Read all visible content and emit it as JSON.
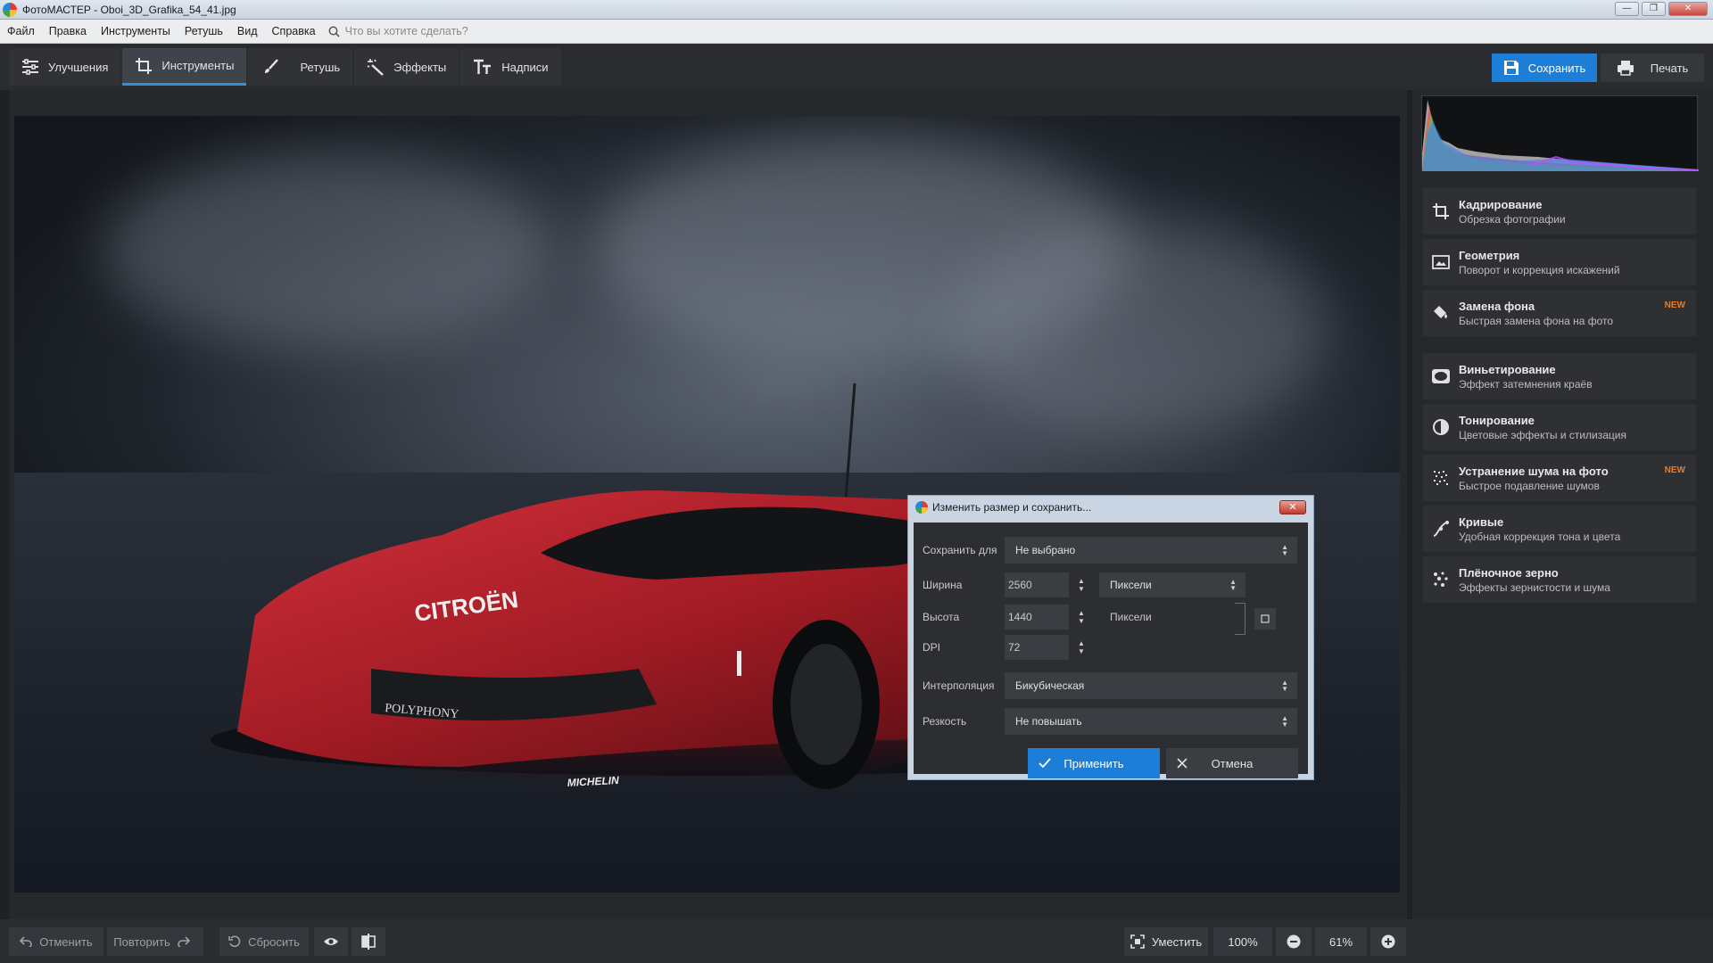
{
  "window": {
    "title": "ФотоМАСТЕР - Oboi_3D_Grafika_54_41.jpg"
  },
  "menu": {
    "items": [
      "Файл",
      "Правка",
      "Инструменты",
      "Ретушь",
      "Вид",
      "Справка"
    ],
    "search_placeholder": "Что вы хотите сделать?"
  },
  "toolbar": {
    "tabs": [
      "Улучшения",
      "Инструменты",
      "Ретушь",
      "Эффекты",
      "Надписи"
    ],
    "active_tab": "Инструменты",
    "save_label": "Сохранить",
    "print_label": "Печать"
  },
  "tools": [
    {
      "title": "Кадрирование",
      "subtitle": "Обрезка фотографии",
      "icon": "crop-icon"
    },
    {
      "title": "Геометрия",
      "subtitle": "Поворот и коррекция искажений",
      "icon": "geometry-icon"
    },
    {
      "title": "Замена фона",
      "subtitle": "Быстрая замена фона на фото",
      "icon": "paint-bucket-icon",
      "badge": "NEW"
    },
    {
      "title": "Виньетирование",
      "subtitle": "Эффект затемнения краёв",
      "icon": "vignette-icon"
    },
    {
      "title": "Тонирование",
      "subtitle": "Цветовые эффекты и стилизация",
      "icon": "toning-icon"
    },
    {
      "title": "Устранение шума на фото",
      "subtitle": "Быстрое подавление шумов",
      "icon": "noise-icon",
      "badge": "NEW"
    },
    {
      "title": "Кривые",
      "subtitle": "Удобная коррекция тона и цвета",
      "icon": "curves-icon"
    },
    {
      "title": "Плёночное зерно",
      "subtitle": "Эффекты зернистости и шума",
      "icon": "grain-icon"
    }
  ],
  "dialog": {
    "title": "Изменить размер и сохранить...",
    "save_for_label": "Сохранить для",
    "save_for_value": "Не выбрано",
    "width_label": "Ширина",
    "width_value": "2560",
    "width_unit": "Пиксели",
    "height_label": "Высота",
    "height_value": "1440",
    "height_unit": "Пиксели",
    "dpi_label": "DPI",
    "dpi_value": "72",
    "interp_label": "Интерполяция",
    "interp_value": "Бикубическая",
    "sharp_label": "Резкость",
    "sharp_value": "Не повышать",
    "apply_label": "Применить",
    "cancel_label": "Отмена"
  },
  "bottombar": {
    "undo_label": "Отменить",
    "redo_label": "Повторить",
    "reset_label": "Сбросить",
    "fit_label": "Уместить",
    "zoom_100": "100%",
    "zoom_value": "61%"
  },
  "photo": {
    "brand_text": "CITROËN",
    "sponsor_1": "POLYPHONY",
    "sponsor_2": "MICHELIN"
  },
  "colors": {
    "accent": "#1d7ed8",
    "badge": "#f07b1f",
    "car": "#b01f27"
  }
}
